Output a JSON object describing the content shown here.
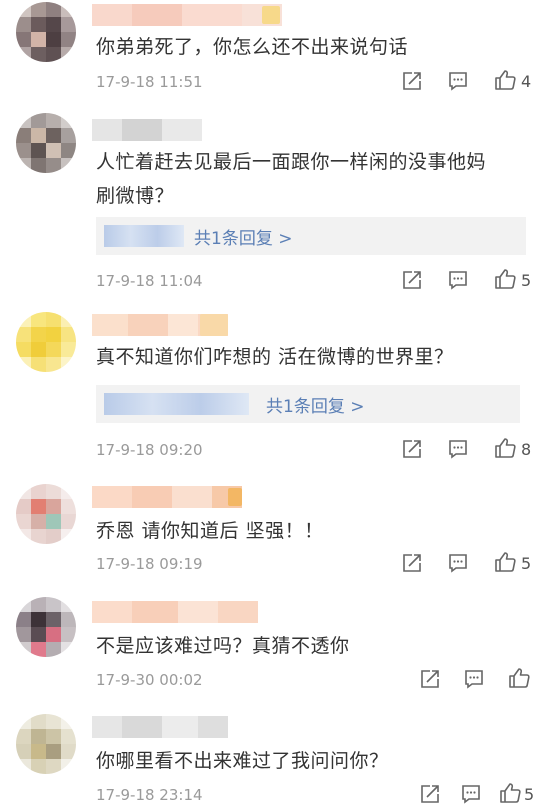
{
  "comments": [
    {
      "text": "你弟弟死了，你怎么还不出来说句话",
      "time": "17-9-18 11:51",
      "likes": "4"
    },
    {
      "text": "人忙着赶去见最后一面跟你一样闲的没事他妈刷微博？",
      "time": "17-9-18 11:04",
      "likes": "5",
      "reply_label": "共1条回复 >"
    },
    {
      "text": "真不知道你们咋想的 活在微博的世界里？",
      "time": "17-9-18 09:20",
      "likes": "8",
      "reply_label": "共1条回复 >"
    },
    {
      "text": "乔恩 请你知道后 坚强！！",
      "time": "17-9-18 09:19",
      "likes": "5"
    },
    {
      "text": "不是应该难过吗？真猜不透你",
      "time": "17-9-30 00:02",
      "likes": ""
    },
    {
      "text": "你哪里看不出来难过了我问问你？",
      "time": "17-9-18 23:14",
      "likes": "5"
    }
  ],
  "icons": {
    "repost": "repost-icon",
    "comment": "comment-icon",
    "like": "thumbs-up-icon"
  },
  "colors": {
    "link": "#5b7fb5",
    "meta": "#9a9a9a",
    "reply_bg": "#f2f2f2"
  }
}
